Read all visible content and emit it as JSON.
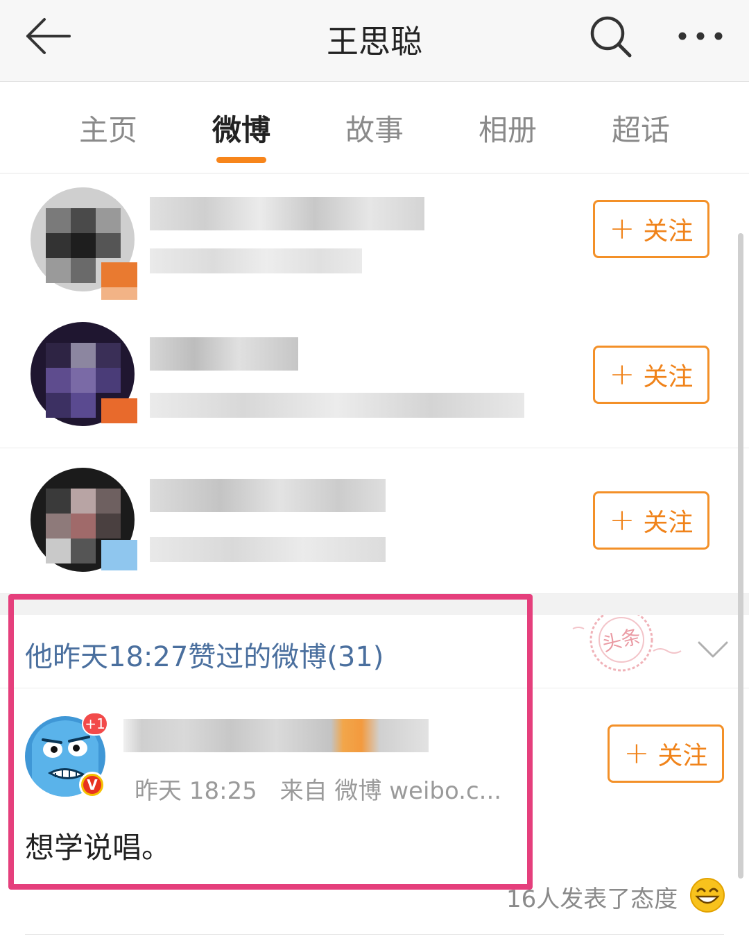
{
  "header": {
    "title": "王思聪",
    "back_icon": "back-arrow-icon",
    "search_icon": "search-icon",
    "more_icon": "more-dots-icon"
  },
  "tabs": [
    {
      "label": "主页",
      "active": false
    },
    {
      "label": "微博",
      "active": true
    },
    {
      "label": "故事",
      "active": false
    },
    {
      "label": "相册",
      "active": false
    },
    {
      "label": "超话",
      "active": false
    }
  ],
  "recommendations": [
    {
      "follow_label": "关注",
      "name_obscured": true
    },
    {
      "follow_label": "关注",
      "name_obscured": true
    },
    {
      "follow_label": "关注",
      "name_obscured": true
    }
  ],
  "liked_section": {
    "heading": "他昨天18:27赞过的微博(31)",
    "stamp_text": "头条"
  },
  "post": {
    "badge": "+1",
    "verified_mark": "V",
    "time": "昨天 18:25",
    "source": "来自 微博 weibo.c...",
    "follow_label": "关注",
    "body": "想学说唱。",
    "reactions": "16人发表了态度"
  },
  "colors": {
    "accent": "#f7851b",
    "link_blue": "#4a6f9e",
    "highlight": "#e53f7c"
  }
}
